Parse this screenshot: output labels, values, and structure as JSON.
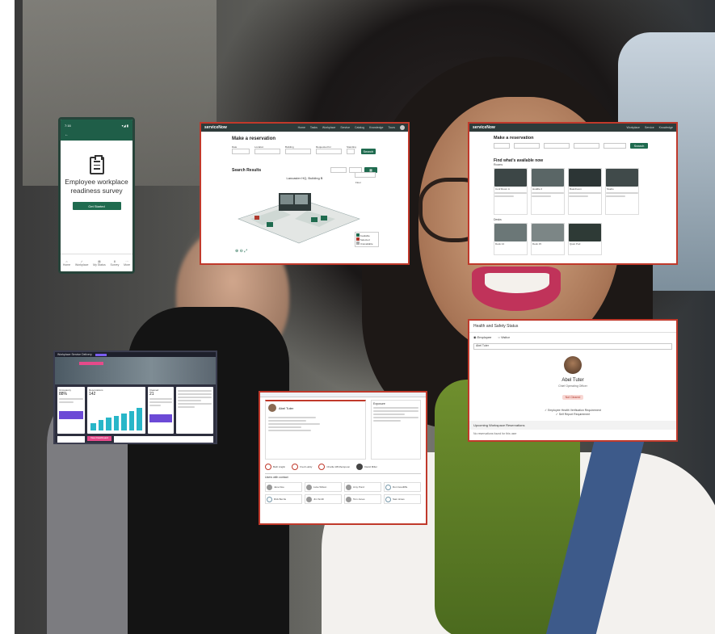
{
  "photo": {
    "alt": "Woman smiling in car passenger seat"
  },
  "phone": {
    "status_time": "7:16",
    "status_icons": "▾◢ ▮",
    "back": "←",
    "title": "Employee workplace readiness survey",
    "button": "Get Started",
    "tabs": [
      "Home",
      "Workplace",
      "My Status",
      "Survey",
      "More"
    ]
  },
  "reservation": {
    "logo": "serviceNow",
    "nav": [
      "Home",
      "Tasks",
      "Workplace",
      "Service",
      "Catalog",
      "Knowledge",
      "Tours"
    ],
    "heading": "Make a reservation",
    "labels": [
      "Date",
      "Location",
      "Building",
      "Requested for",
      "Standing"
    ],
    "search_btn": "Search",
    "results_heading": "Search Results",
    "filter": "Filter",
    "map_title": "Lancaster HQ, Building B",
    "select": "Floor",
    "legend": [
      "Available",
      "Selected",
      "Unavailable"
    ]
  },
  "spaces": {
    "logo": "serviceNow",
    "heading": "Make a reservation",
    "search_btn": "Search",
    "find_heading": "Find what's available now",
    "section1": "Rooms",
    "section2": "Desks",
    "cards": [
      "Conf Room A",
      "Huddle 2",
      "Boardroom",
      "Studio",
      "Desk 14",
      "Desk 15",
      "Quiet Pod"
    ]
  },
  "health": {
    "heading": "Health and Safety Status",
    "radio1": "Employee",
    "radio2": "Visitor",
    "field_value": "Abel Tuter",
    "name": "Abel Tuter",
    "subtitle": "Chief Operating Officer",
    "badge": "Not Cleared",
    "checks": [
      "Employee Health Verification Requirement",
      "Self Report Requirement"
    ],
    "upcoming": "Upcoming Workspace Reservations",
    "none": "No reservations found for this user"
  },
  "contact": {
    "name": "Abel Tuter",
    "exposure": "Exposure",
    "list_heading": "Users with contact",
    "people": [
      "Beth Anglin",
      "Fred Luddy",
      "Charlie Whitherspoon",
      "David Miller",
      "Jane Doe",
      "Luke Wilson",
      "Amy Pond",
      "Don Goodliffe",
      "Rick Berzle",
      "Jim Smith",
      "Tom Jones",
      "Sam Hines"
    ]
  },
  "dashboard": {
    "title": "Workplace Service Delivery",
    "kpi_labels": [
      "Occupancy",
      "Reservations",
      "Cleaned"
    ],
    "kpi_values": [
      "88%",
      "142",
      "21"
    ],
    "button": "View Dashboard",
    "bars": [
      30,
      45,
      55,
      60,
      70,
      80,
      95
    ]
  }
}
